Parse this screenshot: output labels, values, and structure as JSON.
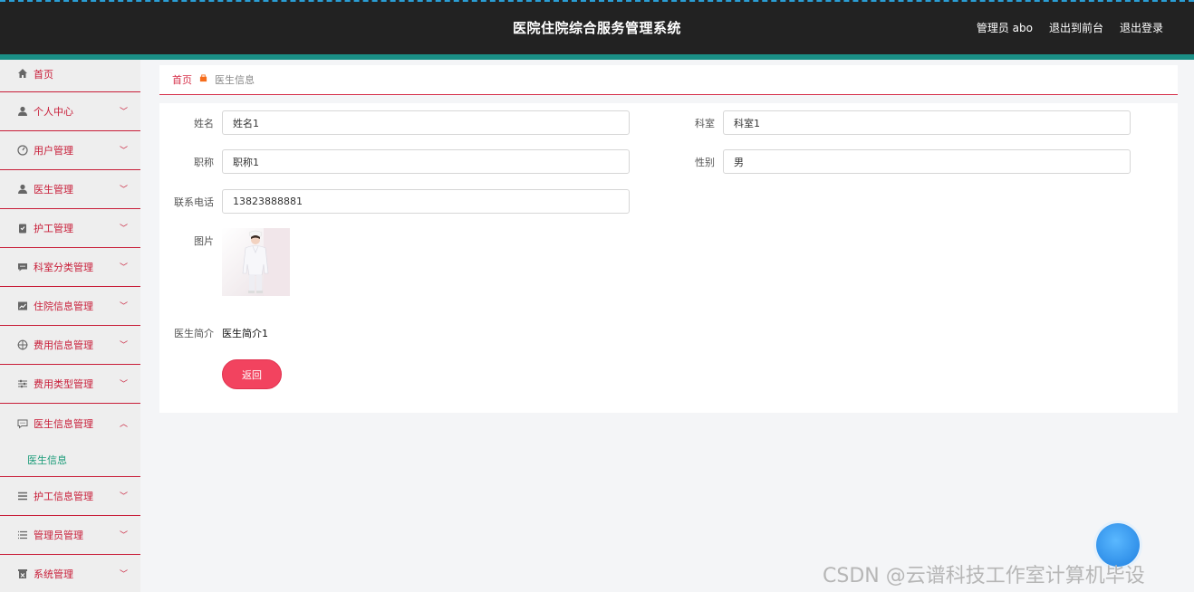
{
  "header": {
    "title": "医院住院综合服务管理系统",
    "user": "管理员 abo",
    "to_front": "退出到前台",
    "logout": "退出登录"
  },
  "sidebar": {
    "items": [
      {
        "label": "首页",
        "icon": "home-icon",
        "expandable": false
      },
      {
        "label": "个人中心",
        "icon": "user-icon",
        "expandable": true
      },
      {
        "label": "用户管理",
        "icon": "gauge-icon",
        "expandable": true
      },
      {
        "label": "医生管理",
        "icon": "user-icon",
        "expandable": true
      },
      {
        "label": "护工管理",
        "icon": "clipboard-icon",
        "expandable": true
      },
      {
        "label": "科室分类管理",
        "icon": "chat-icon",
        "expandable": true
      },
      {
        "label": "住院信息管理",
        "icon": "chart-icon",
        "expandable": true
      },
      {
        "label": "费用信息管理",
        "icon": "target-icon",
        "expandable": true
      },
      {
        "label": "费用类型管理",
        "icon": "sliders-icon",
        "expandable": true
      },
      {
        "label": "医生信息管理",
        "icon": "message-icon",
        "expandable": true,
        "expanded": true
      },
      {
        "label": "护工信息管理",
        "icon": "list-icon",
        "expandable": true
      },
      {
        "label": "管理员管理",
        "icon": "list-icon",
        "expandable": true
      },
      {
        "label": "系统管理",
        "icon": "box-icon",
        "expandable": true
      }
    ],
    "sub_active": "医生信息"
  },
  "breadcrumb": {
    "home": "首页",
    "current": "医生信息"
  },
  "form": {
    "name_label": "姓名",
    "name_value": "姓名1",
    "dept_label": "科室",
    "dept_value": "科室1",
    "title_label": "职称",
    "title_value": "职称1",
    "gender_label": "性别",
    "gender_value": "男",
    "phone_label": "联系电话",
    "phone_value": "13823888881",
    "photo_label": "图片",
    "intro_label": "医生简介",
    "intro_value": "医生简介1",
    "back_label": "返回"
  },
  "watermark": "CSDN @云谱科技工作室计算机毕设",
  "colors": {
    "header_bg": "#222222",
    "accent_red": "#c81d38",
    "teal": "#1a8f86",
    "active_green": "#1a9b78",
    "button_red": "#f2435f"
  }
}
